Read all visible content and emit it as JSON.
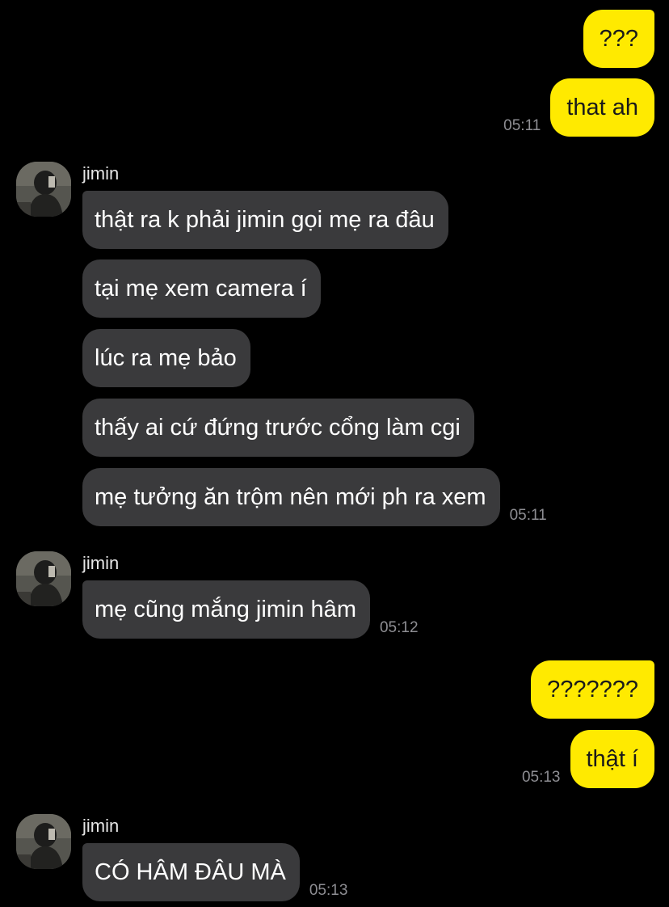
{
  "messages": {
    "m1": {
      "text": "???"
    },
    "m2": {
      "text": "that ah",
      "time": "05:11"
    },
    "g1": {
      "sender": "jimin",
      "m3": "thật ra k phải jimin gọi mẹ ra đâu",
      "m4": "tại mẹ xem camera í",
      "m5": "lúc ra mẹ bảo",
      "m6": "thấy ai cứ đứng trước cổng làm cgi",
      "m7": "mẹ tưởng ăn trộm nên mới ph ra xem",
      "time": "05:11"
    },
    "g2": {
      "sender": "jimin",
      "m8": "mẹ cũng mắng jimin hâm",
      "time": "05:12"
    },
    "m9": {
      "text": "???????"
    },
    "m10": {
      "text": "thật í",
      "time": "05:13"
    },
    "g3": {
      "sender": "jimin",
      "m11": "CÓ HÂM ĐÂU MÀ",
      "time": "05:13"
    }
  },
  "colors": {
    "background": "#000000",
    "my_bubble": "#ffea00",
    "their_bubble": "#3a3a3c",
    "timestamp": "#8e8e93"
  },
  "icons": {
    "avatar": "profile-photo"
  }
}
